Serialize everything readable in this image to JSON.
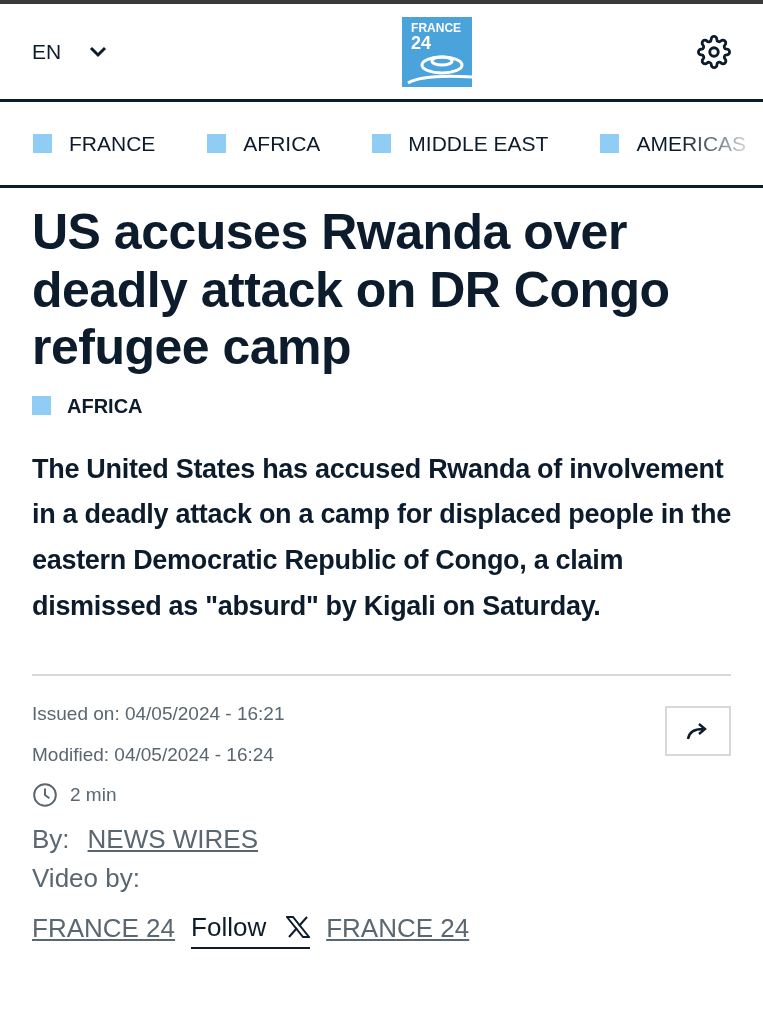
{
  "header": {
    "language": "EN",
    "logo": {
      "line1": "FRANCE",
      "line2": "24"
    }
  },
  "nav": [
    {
      "label": "FRANCE"
    },
    {
      "label": "AFRICA"
    },
    {
      "label": "MIDDLE EAST"
    },
    {
      "label": "AMERICAS"
    }
  ],
  "article": {
    "title": "US accuses Rwanda over deadly attack on DR Congo refugee camp",
    "category": "AFRICA",
    "lead": "The United States has accused Rwanda of involvement in a deadly attack on a camp for displaced people in the eastern Democratic Republic of Congo, a claim dismissed as \"absurd\" by Kigali on Saturday.",
    "issued": "Issued on: 04/05/2024 - 16:21",
    "modified": "Modified: 04/05/2024 - 16:24",
    "reading_time": "2 min",
    "by_label": "By:",
    "author": "NEWS WIRES",
    "video_label": "Video by:",
    "video_author": "FRANCE 24",
    "follow": "Follow",
    "follow_handle": "FRANCE 24"
  }
}
